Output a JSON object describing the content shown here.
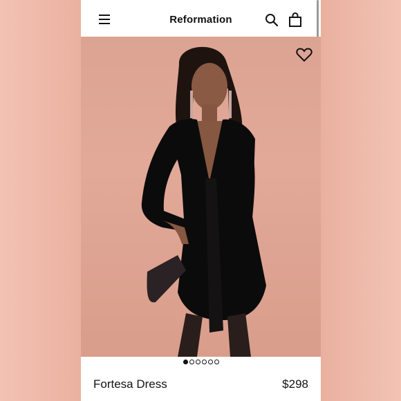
{
  "header": {
    "brand": "Reformation",
    "menu_icon": "hamburger-menu-icon",
    "search_icon": "search-icon",
    "bag_icon": "shopping-bag-icon"
  },
  "gallery": {
    "wishlist_icon": "heart-icon",
    "image_count": 6,
    "active_index": 0
  },
  "product": {
    "name": "Fortesa Dress",
    "price": "$298"
  },
  "colors": {
    "backdrop": "#dca392",
    "text": "#111111"
  }
}
